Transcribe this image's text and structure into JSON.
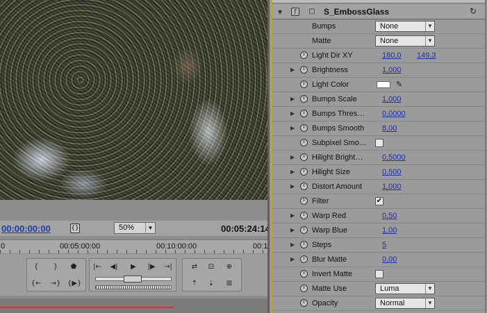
{
  "monitor": {
    "timecode_current": "00:00:00:00",
    "zoom": "50%",
    "timecode_duration": "00:05:24:14",
    "ruler_labels": [
      "0",
      "00:05:00:00",
      "00:10:00:00",
      "00:1"
    ],
    "playback_percent": 65
  },
  "effect": {
    "name": "S_EmbossGlass",
    "badge": "▢",
    "reset_icon": "↻"
  },
  "params": [
    {
      "label": "Bumps",
      "type": "select",
      "value": "None",
      "twirl": false,
      "stopwatch": false
    },
    {
      "label": "Matte",
      "type": "select",
      "value": "None",
      "twirl": false,
      "stopwatch": false
    },
    {
      "label": "Light Dir XY",
      "type": "xy",
      "x": "180,0",
      "y": "149,3",
      "twirl": false,
      "stopwatch": true
    },
    {
      "label": "Brightness",
      "type": "value",
      "value": "1,000",
      "twirl": true,
      "stopwatch": true
    },
    {
      "label": "Light Color",
      "type": "color",
      "value": "#ffffff",
      "twirl": false,
      "stopwatch": true
    },
    {
      "label": "Bumps Scale",
      "type": "value",
      "value": "1,000",
      "twirl": true,
      "stopwatch": true
    },
    {
      "label": "Bumps Thres…",
      "type": "value",
      "value": "0,0000",
      "twirl": true,
      "stopwatch": true
    },
    {
      "label": "Bumps Smooth",
      "type": "value",
      "value": "8,00",
      "twirl": true,
      "stopwatch": true
    },
    {
      "label": "Subpixel Smo…",
      "type": "check",
      "checked": false,
      "twirl": false,
      "stopwatch": true
    },
    {
      "label": "Hilight Bright…",
      "type": "value",
      "value": "0,5000",
      "twirl": true,
      "stopwatch": true
    },
    {
      "label": "Hilight Size",
      "type": "value",
      "value": "0,500",
      "twirl": true,
      "stopwatch": true
    },
    {
      "label": "Distort Amount",
      "type": "value",
      "value": "1,000",
      "twirl": true,
      "stopwatch": true
    },
    {
      "label": "Filter",
      "type": "check",
      "checked": true,
      "twirl": false,
      "stopwatch": true
    },
    {
      "label": "Warp Red",
      "type": "value",
      "value": "0,50",
      "twirl": true,
      "stopwatch": true
    },
    {
      "label": "Warp Blue",
      "type": "value",
      "value": "1,00",
      "twirl": true,
      "stopwatch": true
    },
    {
      "label": "Steps",
      "type": "value",
      "value": "5",
      "twirl": true,
      "stopwatch": true
    },
    {
      "label": "Blur Matte",
      "type": "value",
      "value": "0,00",
      "twirl": true,
      "stopwatch": true
    },
    {
      "label": "Invert Matte",
      "type": "check",
      "checked": false,
      "twirl": false,
      "stopwatch": true
    },
    {
      "label": "Matte Use",
      "type": "select",
      "value": "Luma",
      "twirl": false,
      "stopwatch": true
    },
    {
      "label": "Opacity",
      "type": "select",
      "value": "Normal",
      "twirl": false,
      "stopwatch": true
    }
  ]
}
